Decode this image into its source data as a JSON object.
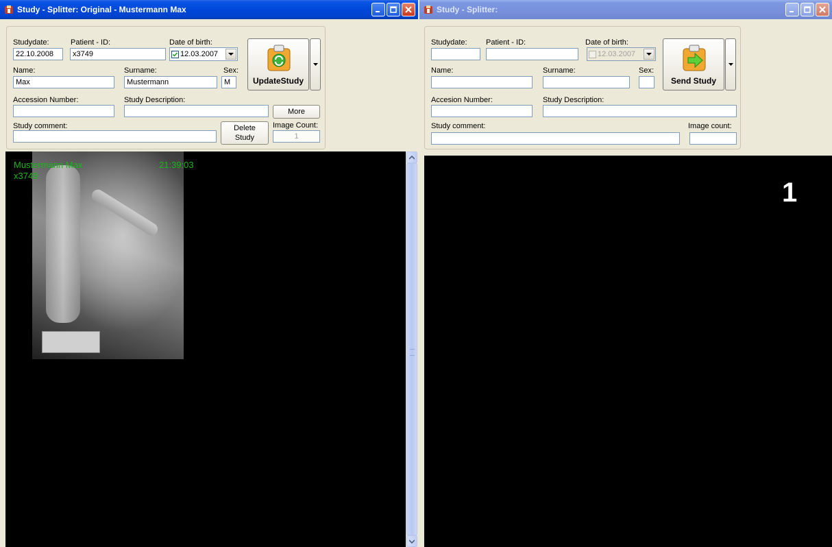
{
  "left_window": {
    "title": "Study - Splitter: Original - Mustermann Max",
    "labels": {
      "studydate": "Studydate:",
      "patient_id": "Patient - ID:",
      "dob": "Date of birth:",
      "name": "Name:",
      "surname": "Surname:",
      "sex": "Sex:",
      "accession": "Accession Number:",
      "study_description": "Study Description:",
      "study_comment": "Study comment:",
      "image_count": "Image Count:"
    },
    "values": {
      "studydate": "22.10.2008",
      "patient_id": "x3749",
      "dob": "12.03.2007",
      "dob_checked": true,
      "name": "Max",
      "surname": "Mustermann",
      "sex": "M",
      "accession": "",
      "study_description": "",
      "study_comment": "",
      "image_count": "1"
    },
    "buttons": {
      "update_study": "UpdateStudy",
      "more": "More",
      "delete_study_line1": "Delete",
      "delete_study_line2": "Study"
    },
    "viewer": {
      "patient_name": "Mustermann Max",
      "patient_id": "x3749",
      "time": "21:39:03"
    }
  },
  "right_window": {
    "title": "Study - Splitter:",
    "labels": {
      "studydate": "Studydate:",
      "patient_id": "Patient - ID:",
      "dob": "Date of birth:",
      "name": "Name:",
      "surname": "Surname:",
      "sex": "Sex:",
      "accession": "Accesion Number:",
      "study_description": "Study Description:",
      "study_comment": "Study comment:",
      "image_count": "Image count:"
    },
    "values": {
      "studydate": "",
      "patient_id": "",
      "dob": "12.03.2007",
      "dob_checked": false,
      "name": "",
      "surname": "",
      "sex": "",
      "accession": "",
      "study_description": "",
      "study_comment": "",
      "image_count": ""
    },
    "buttons": {
      "send_study": "Send Study"
    },
    "viewer": {
      "image_number": "1"
    }
  },
  "icons": {
    "app": "app-icon",
    "update": "clipboard-recycle-icon",
    "send": "clipboard-arrow-icon"
  },
  "colors": {
    "titlebar_active": "#0047d8",
    "titlebar_inactive": "#7b97e0",
    "overlay_text": "#18b818",
    "viewer_bg": "#000000",
    "panel_bg": "#ece9d8"
  }
}
